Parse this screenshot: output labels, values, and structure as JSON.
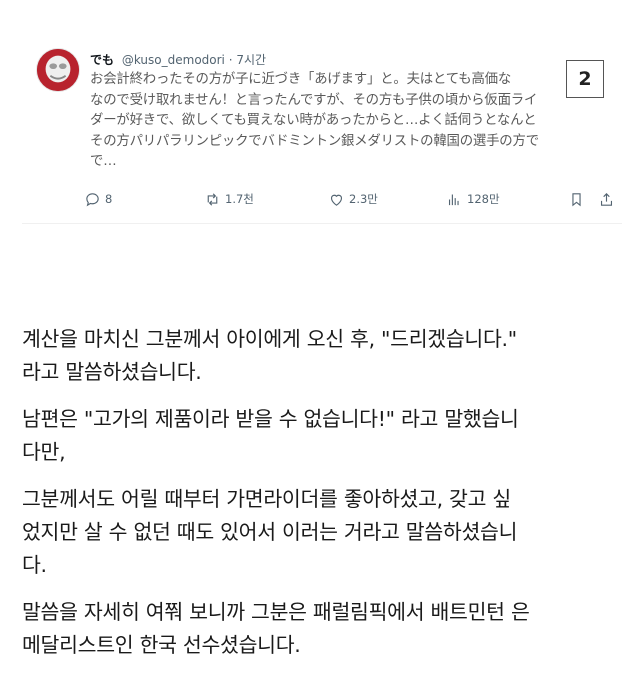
{
  "tweet": {
    "name": "でも",
    "handle": "@kuso_demodori",
    "separator": "·",
    "time": "7시간",
    "lines": [
      "お会計終わったその方が子に近づき「あげます」と。夫はとても高価な",
      "なので受け取れません！と言ったんですが、その方も子供の頃から仮面ライ",
      "ダーが好きで、欲しくても買えない時があったからと…よく話伺うとなんと",
      "その方パリパラリンピックでバドミントン銀メダリストの韓国の選手の方で",
      "で…"
    ],
    "actions": {
      "replies": "8",
      "reposts": "1.7천",
      "likes": "2.3만",
      "views": "128만"
    }
  },
  "badge": {
    "number": "2"
  },
  "article": {
    "paragraphs": [
      [
        "계산을 마치신 그분께서 아이에게 오신 후, \"드리겠습니다.\"",
        "라고 말씀하셨습니다."
      ],
      [
        "남편은 \"고가의 제품이라 받을 수 없습니다!\" 라고 말했습니",
        "다만,"
      ],
      [
        "그분께서도 어릴 때부터 가면라이더를 좋아하셨고, 갖고 싶",
        "었지만 살 수 없던 때도 있어서 이러는 거라고 말씀하셨습니",
        "다."
      ],
      [
        "말씀을 자세히 여쭤 보니까 그분은 패럴림픽에서 배트민턴 은",
        "메달리스트인 한국 선수셨습니다."
      ]
    ]
  },
  "icons": {
    "reply": "reply-icon",
    "repost": "repost-icon",
    "like": "heart-icon",
    "views": "views-icon",
    "bookmark": "bookmark-icon",
    "share": "share-icon"
  }
}
